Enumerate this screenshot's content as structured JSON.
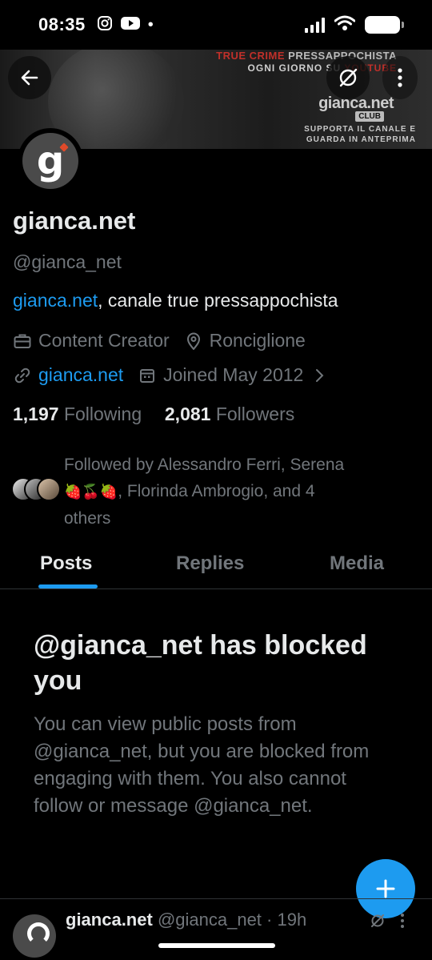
{
  "status_bar": {
    "time": "08:35",
    "app_icons": [
      "instagram-icon",
      "youtube-icon"
    ],
    "dot": "•"
  },
  "banner": {
    "line1_red": "TRUE CRIME",
    "line1_rest": " PRESSAPPOCHISTA",
    "line2_a": "OGNI GIORNO SU ",
    "line2_red": "YOUTUBE",
    "brand": "gianca.net",
    "club": "CLUB",
    "support_1": "SUPPORTA IL CANALE E",
    "support_2": "GUARDA IN ANTEPRIMA"
  },
  "profile": {
    "display_name": "gianca.net",
    "handle": "@gianca_net",
    "bio_link": "gianca.net",
    "bio_rest": ", canale true pressappochista",
    "category": "Content Creator",
    "location": "Ronciglione",
    "website": "gianca.net",
    "joined": "Joined May 2012",
    "following_count": "1,197",
    "following_label": "Following",
    "followers_count": "2,081",
    "followers_label": "Followers"
  },
  "followed_by": {
    "prefix": "Followed by Alessandro Ferri, Serena",
    "emoji": "🍓🍒🍓",
    "rest": ", Florinda Ambrogio, and 4",
    "last": "others"
  },
  "tabs": [
    {
      "label": "Posts",
      "active": true
    },
    {
      "label": "Replies",
      "active": false
    },
    {
      "label": "Media",
      "active": false
    }
  ],
  "blocked": {
    "title": "@gianca_net has blocked you",
    "description": "You can view public posts from @gianca_net, but you are blocked from engaging with them. You also cannot follow or message @gianca_net."
  },
  "post_preview": {
    "name": "gianca.net",
    "handle": "@gianca_net",
    "separator": " · ",
    "time": "19h"
  },
  "colors": {
    "accent": "#1d9bf0",
    "text": "#e7e9ea",
    "muted": "#71767b",
    "background": "#000000"
  }
}
